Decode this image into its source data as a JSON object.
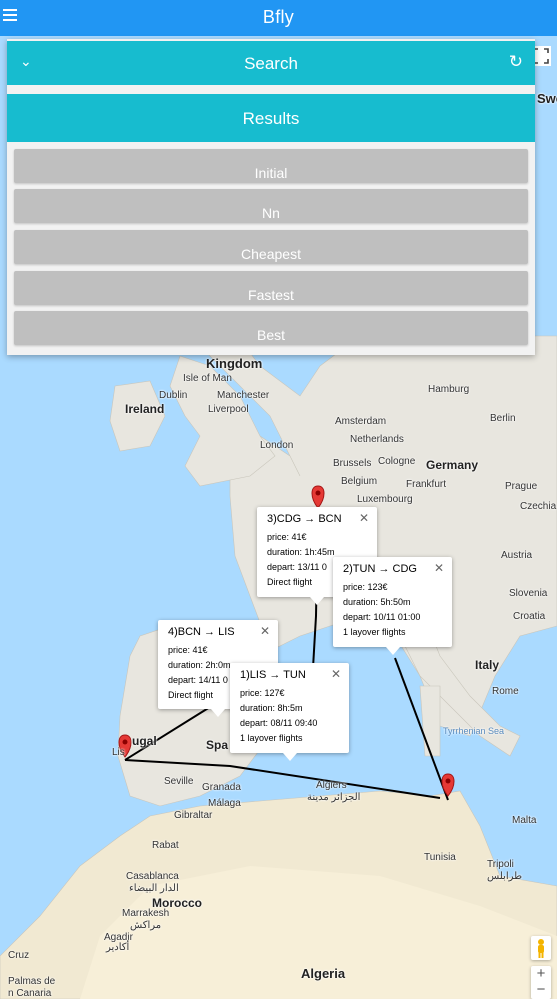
{
  "app": {
    "title": "Bfly"
  },
  "panel": {
    "search_label": "Search",
    "results_label": "Results",
    "buttons": [
      "Initial",
      "Nn",
      "Cheapest",
      "Fastest",
      "Best"
    ]
  },
  "map": {
    "labels": {
      "kingdom": "Kingdom",
      "isle_of_man": "Isle of Man",
      "ireland": "Ireland",
      "dublin": "Dublin",
      "manchester": "Manchester",
      "liverpool": "Liverpool",
      "london": "London",
      "amsterdam": "Amsterdam",
      "netherlands": "Netherlands",
      "brussels": "Brussels",
      "belgium": "Belgium",
      "cologne": "Cologne",
      "luxembourg": "Luxembourg",
      "hamburg": "Hamburg",
      "berlin": "Berlin",
      "germany": "Germany",
      "frankfurt": "Frankfurt",
      "prague": "Prague",
      "czechia": "Czechia",
      "austria": "Austria",
      "slovenia": "Slovenia",
      "croatia": "Croatia",
      "italy": "Italy",
      "rome": "Rome",
      "tyrrhenian_sea": "Tyrrhenian Sea",
      "sweden_partial": "Swe",
      "portugal_partial": "ugal",
      "lisbon_partial": "Lis",
      "spain_partial": "Spa",
      "seville": "Seville",
      "granada": "Granada",
      "malaga": "Málaga",
      "gibraltar": "Gibraltar",
      "algiers": "Algiers",
      "algiers_ar": "الجزائر مدينة",
      "malta": "Malta",
      "tunisia": "Tunisia",
      "tripoli": "Tripoli",
      "tripoli_ar": "طرابلس",
      "rabat": "Rabat",
      "casablanca": "Casablanca",
      "casablanca_ar": "الدار البيضاء",
      "morocco": "Morocco",
      "marrakesh": "Marrakesh",
      "marrakesh_ar": "مراكش",
      "agadir": "Agadir",
      "agadir_ar": "أكادير",
      "cruz_partial": "Cruz",
      "palmas": "Palmas de",
      "palmas2": "n Canaria",
      "algeria": "Algeria"
    },
    "zoom_in": "+",
    "zoom_out": "−"
  },
  "flights": [
    {
      "title": "3)CDG → BCN",
      "price": "price: 41€",
      "duration": "duration: 1h:45m",
      "depart": "depart: 13/11 0",
      "stops": "Direct flight"
    },
    {
      "title": "2)TUN → CDG",
      "price": "price: 123€",
      "duration": "duration: 5h:50m",
      "depart": "depart: 10/11 01:00",
      "stops": "1 layover flights"
    },
    {
      "title": "4)BCN → LIS",
      "price": "price: 41€",
      "duration": "duration: 2h:0m",
      "depart": "depart: 14/11 0",
      "stops": "Direct flight"
    },
    {
      "title": "1)LIS → TUN",
      "price": "price: 127€",
      "duration": "duration: 8h:5m",
      "depart": "depart: 08/11 09:40",
      "stops": "1 layover flights"
    }
  ]
}
